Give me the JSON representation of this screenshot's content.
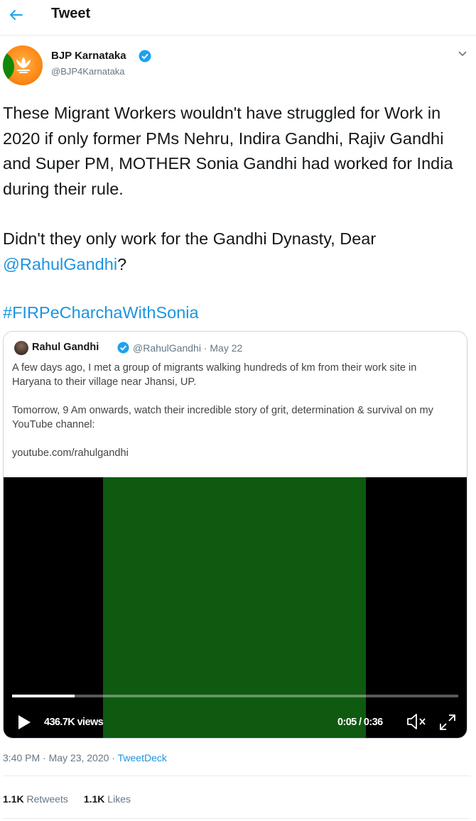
{
  "header": {
    "title": "Tweet"
  },
  "author": {
    "name": "BJP Karnataka",
    "handle": "@BJP4Karnataka"
  },
  "tweet": {
    "para1": "These Migrant Workers wouldn't have struggled for Work in 2020 if only former PMs Nehru, Indira Gandhi, Rajiv Gandhi and Super PM, MOTHER Sonia Gandhi had worked for India during their rule.",
    "para2_prefix": "Didn't they only work for the Gandhi Dynasty, Dear ",
    "para2_mention": "@RahulGandhi",
    "para2_suffix": "?",
    "hashtag": "#FIRPeCharchaWithSonia"
  },
  "quoted": {
    "name": "Rahul Gandhi",
    "handle_date": "@RahulGandhi · May 22",
    "line1": "A few days ago, I met a group of migrants walking hundreds of km from their work site in Haryana to their village near Jhansi, UP.",
    "line2": "Tomorrow, 9 Am onwards, watch their incredible story of grit, determination & survival on my YouTube channel:",
    "link": "youtube.com/rahulgandhi"
  },
  "video": {
    "views": "436.7K views",
    "time": "0:05 / 0:36",
    "progress_fraction": 0.14
  },
  "meta": {
    "timestamp": "3:40 PM · May 23, 2020 · ",
    "source": "TweetDeck"
  },
  "stats": {
    "retweets_count": "1.1K",
    "retweets_label": "Retweets",
    "likes_count": "1.1K",
    "likes_label": "Likes"
  },
  "colors": {
    "link": "#1b95e0",
    "verified": "#1da1f2",
    "secondary": "#657786"
  },
  "icons": [
    "back-arrow-icon",
    "verified-icon",
    "chevron-down-icon",
    "play-icon",
    "mute-icon",
    "fullscreen-icon"
  ]
}
